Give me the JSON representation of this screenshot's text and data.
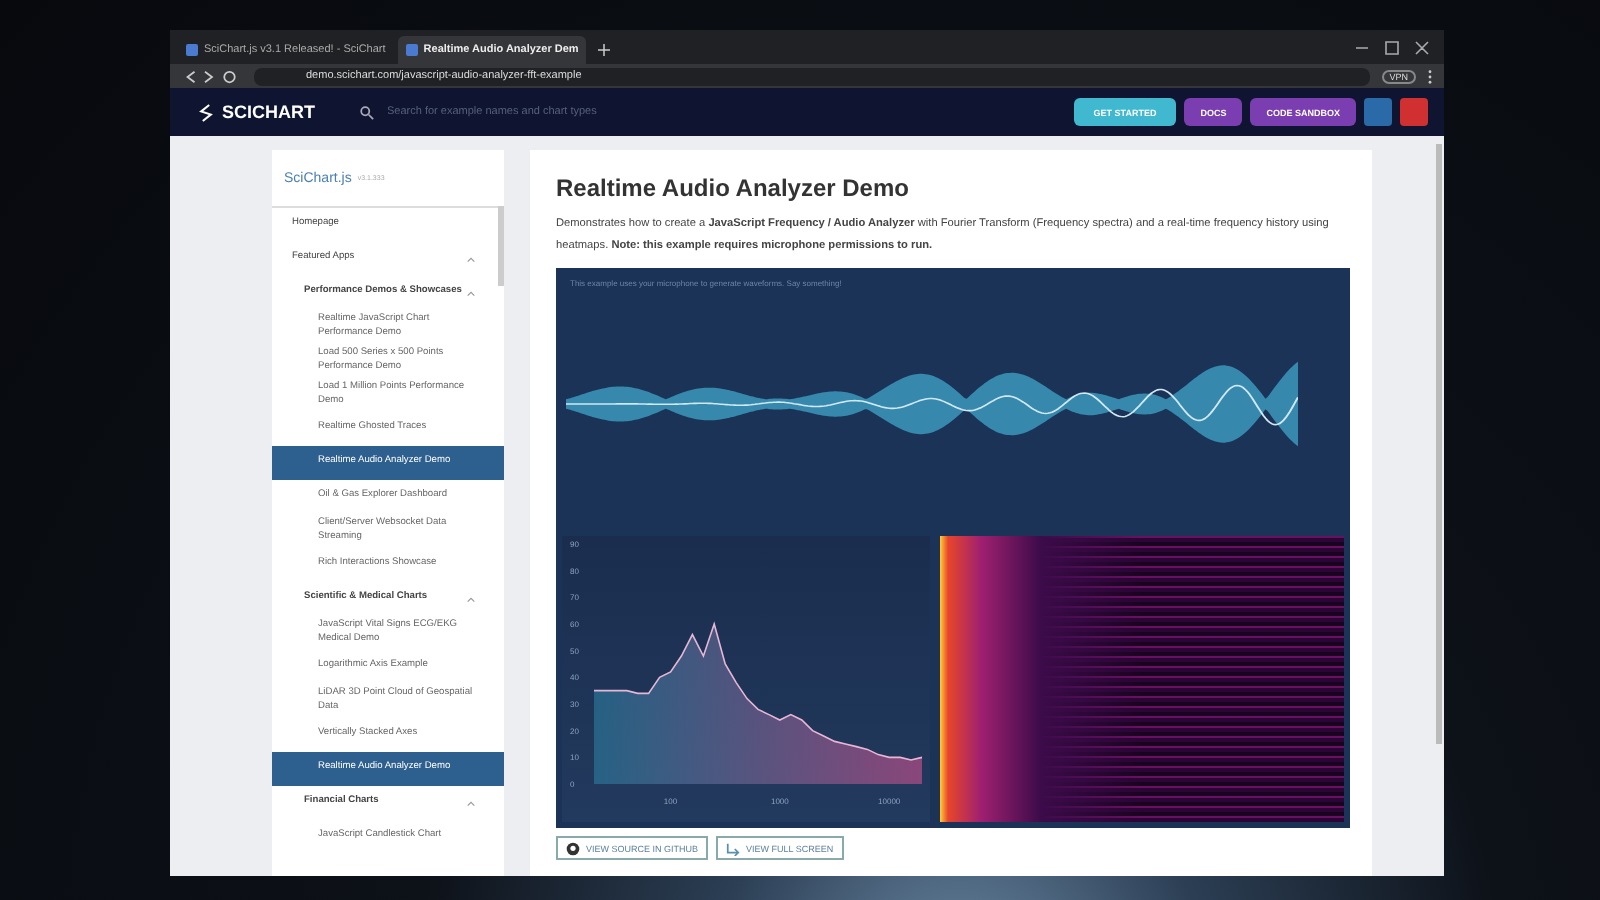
{
  "browser": {
    "tabs": [
      {
        "label": "SciChart.js v3.1 Released! - SciChart",
        "selected": false
      },
      {
        "label": "Realtime Audio Analyzer Dem",
        "selected": true
      }
    ],
    "address": "demo.scichart.com/javascript-audio-analyzer-fft-example",
    "vpn_badge": "VPN"
  },
  "site_header": {
    "logo": "SCICHART",
    "search": {
      "placeholder": "Search for example names and chart types"
    },
    "buttons": [
      {
        "label": "GET STARTED",
        "kind": "start"
      },
      {
        "label": "DOCS",
        "kind": "docs"
      },
      {
        "label": "CODE SANDBOX",
        "kind": "sandbox"
      }
    ]
  },
  "sidebar": {
    "title": "SciChart.js",
    "version": "v3.1.333",
    "items": [
      {
        "label": "Homepage",
        "selected": false
      },
      {
        "label": "Featured Apps",
        "selected": false,
        "expanded": true,
        "children": [
          {
            "label": "Performance Demos & Showcases",
            "selected": false,
            "expanded": true,
            "children": [
              {
                "label": "Realtime JavaScript Chart Performance Demo",
                "selected": false
              },
              {
                "label": "Load 500 Series x 500 Points Performance Demo",
                "selected": false
              },
              {
                "label": "Load 1 Million Points Performance Demo",
                "selected": false
              },
              {
                "label": "Realtime Ghosted Traces",
                "selected": false
              },
              {
                "label": "Realtime Audio Analyzer Demo",
                "selected": true
              },
              {
                "label": "Oil & Gas Explorer Dashboard",
                "selected": false
              },
              {
                "label": "Client/Server Websocket Data Streaming",
                "selected": false
              },
              {
                "label": "Rich Interactions Showcase",
                "selected": false
              }
            ]
          },
          {
            "label": "Scientific & Medical Charts",
            "selected": false,
            "expanded": true,
            "children": [
              {
                "label": "JavaScript Vital Signs ECG/EKG Medical Demo",
                "selected": false
              },
              {
                "label": "Logarithmic Axis Example",
                "selected": false
              },
              {
                "label": "LiDAR 3D Point Cloud of Geospatial Data",
                "selected": false
              },
              {
                "label": "Vertically Stacked Axes",
                "selected": false
              },
              {
                "label": "Realtime Audio Analyzer Demo",
                "selected": true
              }
            ]
          },
          {
            "label": "Financial Charts",
            "selected": false,
            "expanded": true,
            "children": [
              {
                "label": "JavaScript Candlestick Chart",
                "selected": false
              }
            ]
          }
        ]
      }
    ]
  },
  "main": {
    "title": "Realtime Audio Analyzer Demo",
    "description": "Demonstrates how to create a **JavaScript Frequency / Audio Analyzer** with Fourier Transform (Frequency spectra) and a real-time frequency history using heatmaps. **Note: this example requires microphone permissions to run.**",
    "chart_hint": "This example uses your microphone to generate waveforms. Say something!",
    "spectrum": {
      "chart_data": {
        "type": "area",
        "categories": [
          null,
          null,
          null,
          null,
          null,
          null,
          null,
          "100",
          null,
          null,
          null,
          null,
          null,
          null,
          null,
          null,
          null,
          "1000",
          null,
          null,
          null,
          null,
          null,
          null,
          null,
          null,
          null,
          "10000",
          null,
          null,
          null
        ],
        "values": [
          35,
          35,
          35,
          35,
          34,
          34,
          40,
          42,
          48,
          56,
          48,
          60,
          45,
          38,
          32,
          28,
          26,
          24,
          26,
          24,
          20,
          18,
          16,
          15,
          14,
          13,
          11,
          10,
          10,
          9,
          10
        ],
        "ylim": [
          0,
          90
        ],
        "yticks": [
          0,
          10,
          20,
          30,
          40,
          50,
          60,
          70,
          80,
          90
        ]
      }
    },
    "buttons": [
      {
        "label": "VIEW SOURCE IN GITHUB",
        "kind": "github"
      },
      {
        "label": "VIEW FULL SCREEN",
        "kind": "fullscreen"
      }
    ]
  }
}
